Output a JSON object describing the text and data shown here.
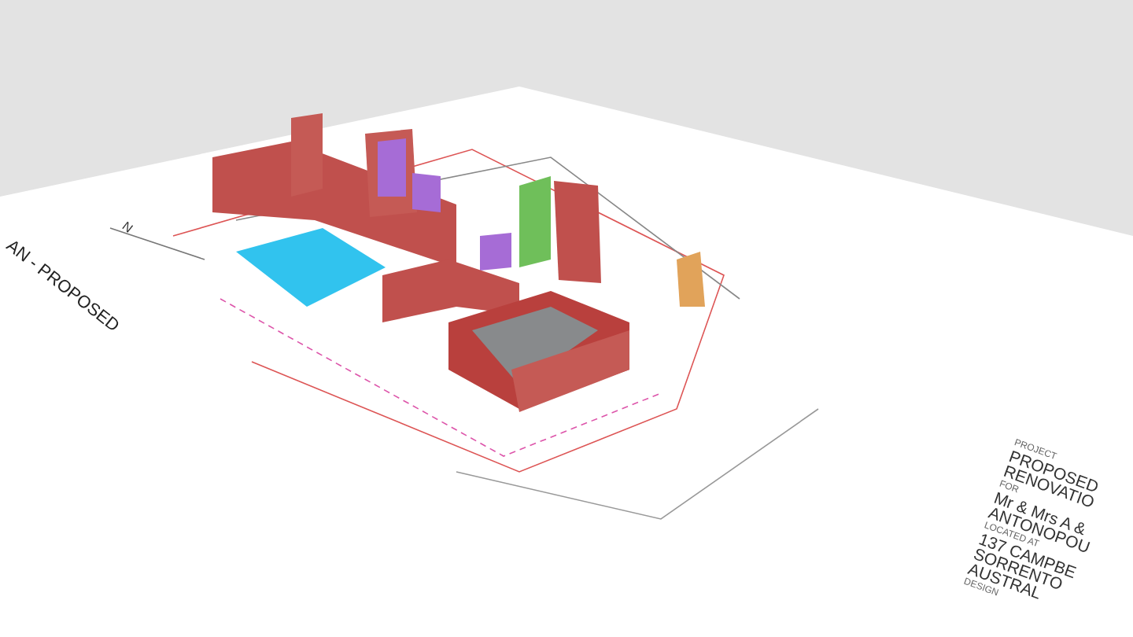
{
  "scene": {
    "drawing_title": "AN - PROPOSED",
    "north_label": "N",
    "title_block": [
      {
        "kind": "label",
        "text": "PROJECT"
      },
      {
        "kind": "value",
        "text": "PROPOSED"
      },
      {
        "kind": "value",
        "text": "RENOVATIO"
      },
      {
        "kind": "label",
        "text": "FOR"
      },
      {
        "kind": "value",
        "text": "Mr & Mrs A &"
      },
      {
        "kind": "value",
        "text": "ANTONOPOU"
      },
      {
        "kind": "label",
        "text": "LOCATED AT"
      },
      {
        "kind": "value",
        "text": "137 CAMPBE"
      },
      {
        "kind": "value",
        "text": "SORRENTO"
      },
      {
        "kind": "value",
        "text": "AUSTRAL"
      },
      {
        "kind": "label",
        "text": "DESIGN"
      }
    ]
  }
}
